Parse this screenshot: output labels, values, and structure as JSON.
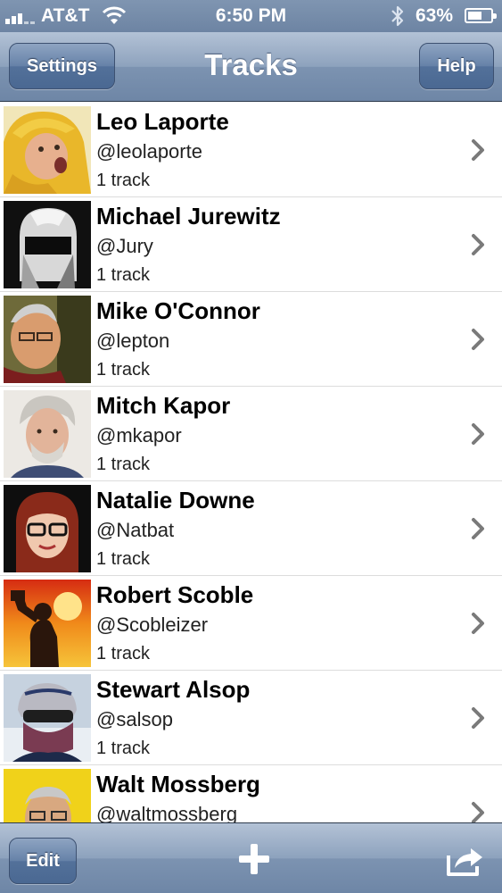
{
  "status_bar": {
    "carrier": "AT&T",
    "time": "6:50 PM",
    "battery_percent": "63%",
    "battery_level": 0.63
  },
  "nav": {
    "title": "Tracks",
    "left_button": "Settings",
    "right_button": "Help"
  },
  "tracks": [
    {
      "name": "Leo Laporte",
      "handle": "@leolaporte",
      "count": "1 track"
    },
    {
      "name": "Michael Jurewitz",
      "handle": "@Jury",
      "count": "1 track"
    },
    {
      "name": "Mike O'Connor",
      "handle": "@lepton",
      "count": "1 track"
    },
    {
      "name": "Mitch Kapor",
      "handle": "@mkapor",
      "count": "1 track"
    },
    {
      "name": "Natalie Downe",
      "handle": "@Natbat",
      "count": "1 track"
    },
    {
      "name": "Robert Scoble",
      "handle": "@Scobleizer",
      "count": "1 track"
    },
    {
      "name": "Stewart Alsop",
      "handle": "@salsop",
      "count": "1 track"
    },
    {
      "name": "Walt Mossberg",
      "handle": "@waltmossberg",
      "count": ""
    }
  ],
  "toolbar": {
    "edit_button": "Edit",
    "add_icon": "plus-icon",
    "share_icon": "share-icon"
  },
  "colors": {
    "bar_blue": "#6e86a6",
    "button_blue": "#4a6892"
  }
}
